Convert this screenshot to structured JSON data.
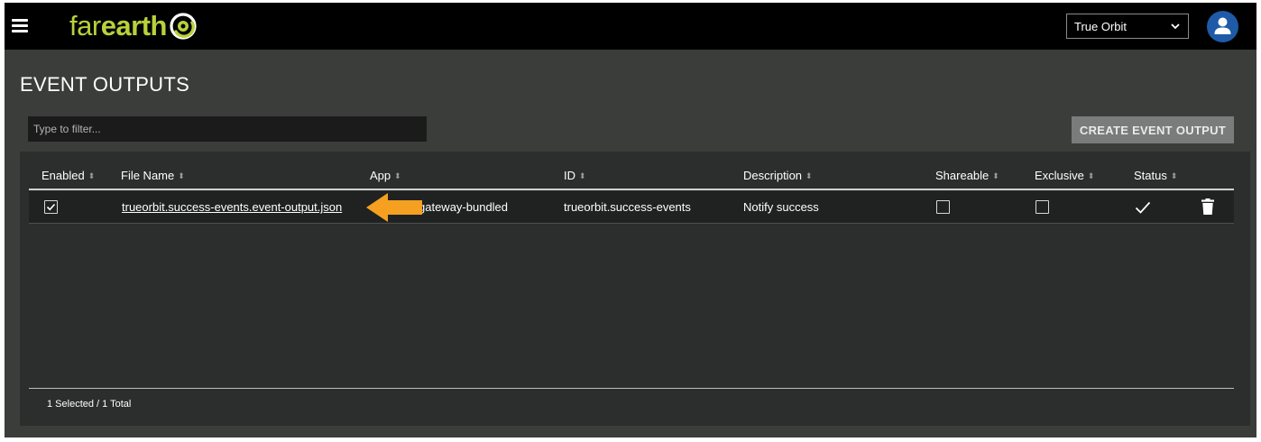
{
  "header": {
    "logo_far": "far",
    "logo_earth": "earth",
    "org_select_value": "True Orbit",
    "avatar_icon": "user-icon",
    "brand_color": "#b9d13b",
    "avatar_color": "#1e5aa8"
  },
  "page": {
    "title": "EVENT OUTPUTS"
  },
  "toolbar": {
    "filter_placeholder": "Type to filter...",
    "create_label": "CREATE EVENT OUTPUT"
  },
  "table": {
    "columns": [
      "Enabled",
      "File Name",
      "App",
      "ID",
      "Description",
      "Shareable",
      "Exclusive",
      "Status"
    ],
    "rows": [
      {
        "enabled": true,
        "file_name": "trueorbit.success-events.event-output.json",
        "app": "gateway-bundled",
        "id": "trueorbit.success-events",
        "description": "Notify success",
        "shareable": false,
        "exclusive": false,
        "status_icon": "check-icon",
        "action_icon": "trash-icon"
      }
    ]
  },
  "annotation": {
    "arrow_color": "#f5a021"
  },
  "footer": {
    "summary": "1 Selected / 1 Total"
  }
}
